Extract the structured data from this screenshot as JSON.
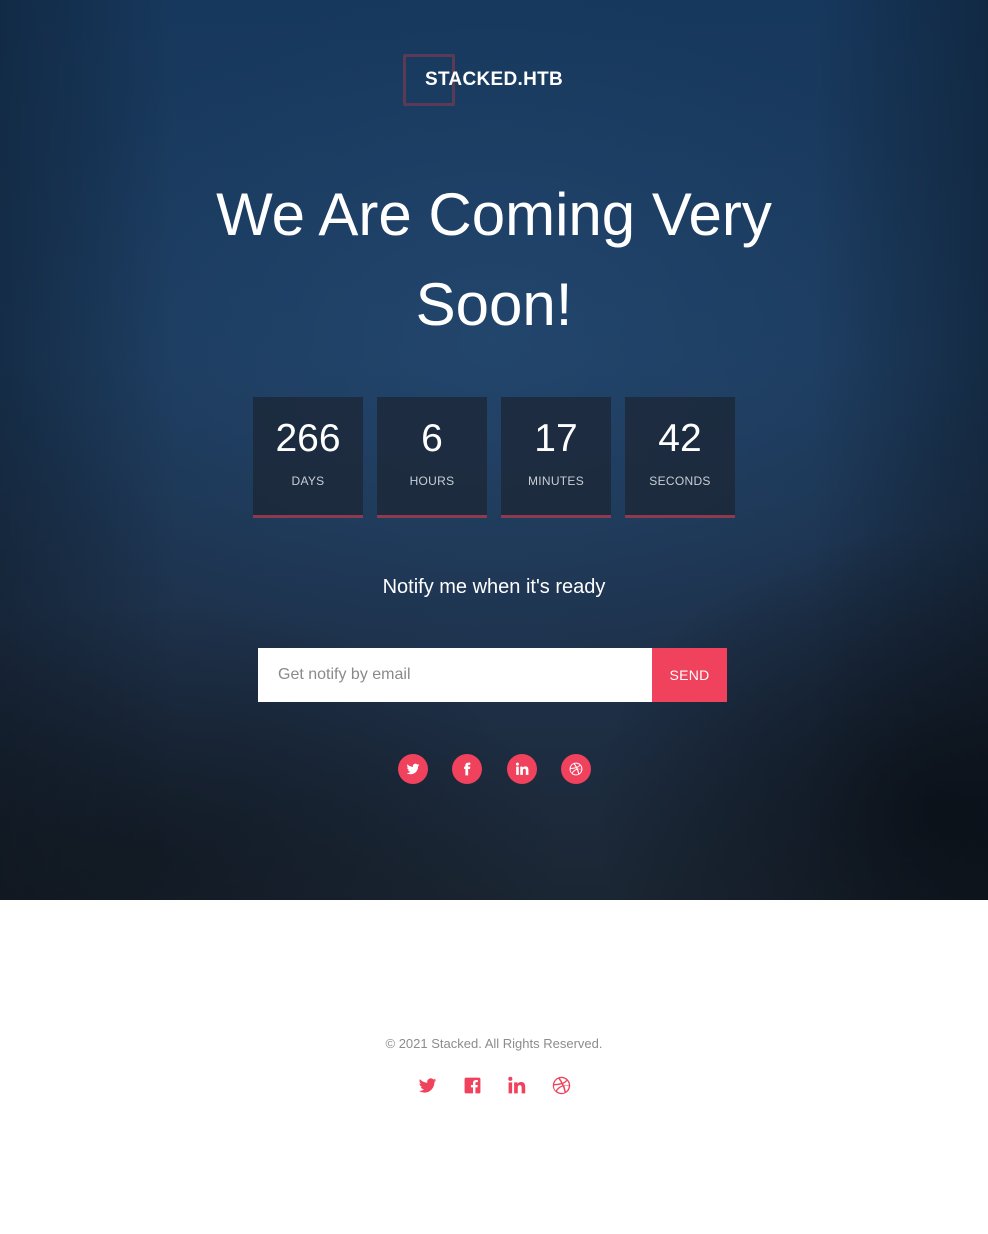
{
  "brand": {
    "logo_text": "STACKED.HTB"
  },
  "hero": {
    "headline": "We Are Coming Very Soon!"
  },
  "countdown": [
    {
      "value": "266",
      "label": "DAYS"
    },
    {
      "value": "6",
      "label": "HOURS"
    },
    {
      "value": "17",
      "label": "MINUTES"
    },
    {
      "value": "42",
      "label": "SECONDS"
    }
  ],
  "notify": {
    "heading": "Notify me when it's ready",
    "email_placeholder": "Get notify by email",
    "email_value": "",
    "send_label": "SEND"
  },
  "social": {
    "icons": [
      "twitter-icon",
      "facebook-icon",
      "linkedin-icon",
      "dribbble-icon"
    ],
    "accent_color": "#f0415d"
  },
  "footer": {
    "copyright": "© 2021 Stacked. All Rights Reserved."
  }
}
